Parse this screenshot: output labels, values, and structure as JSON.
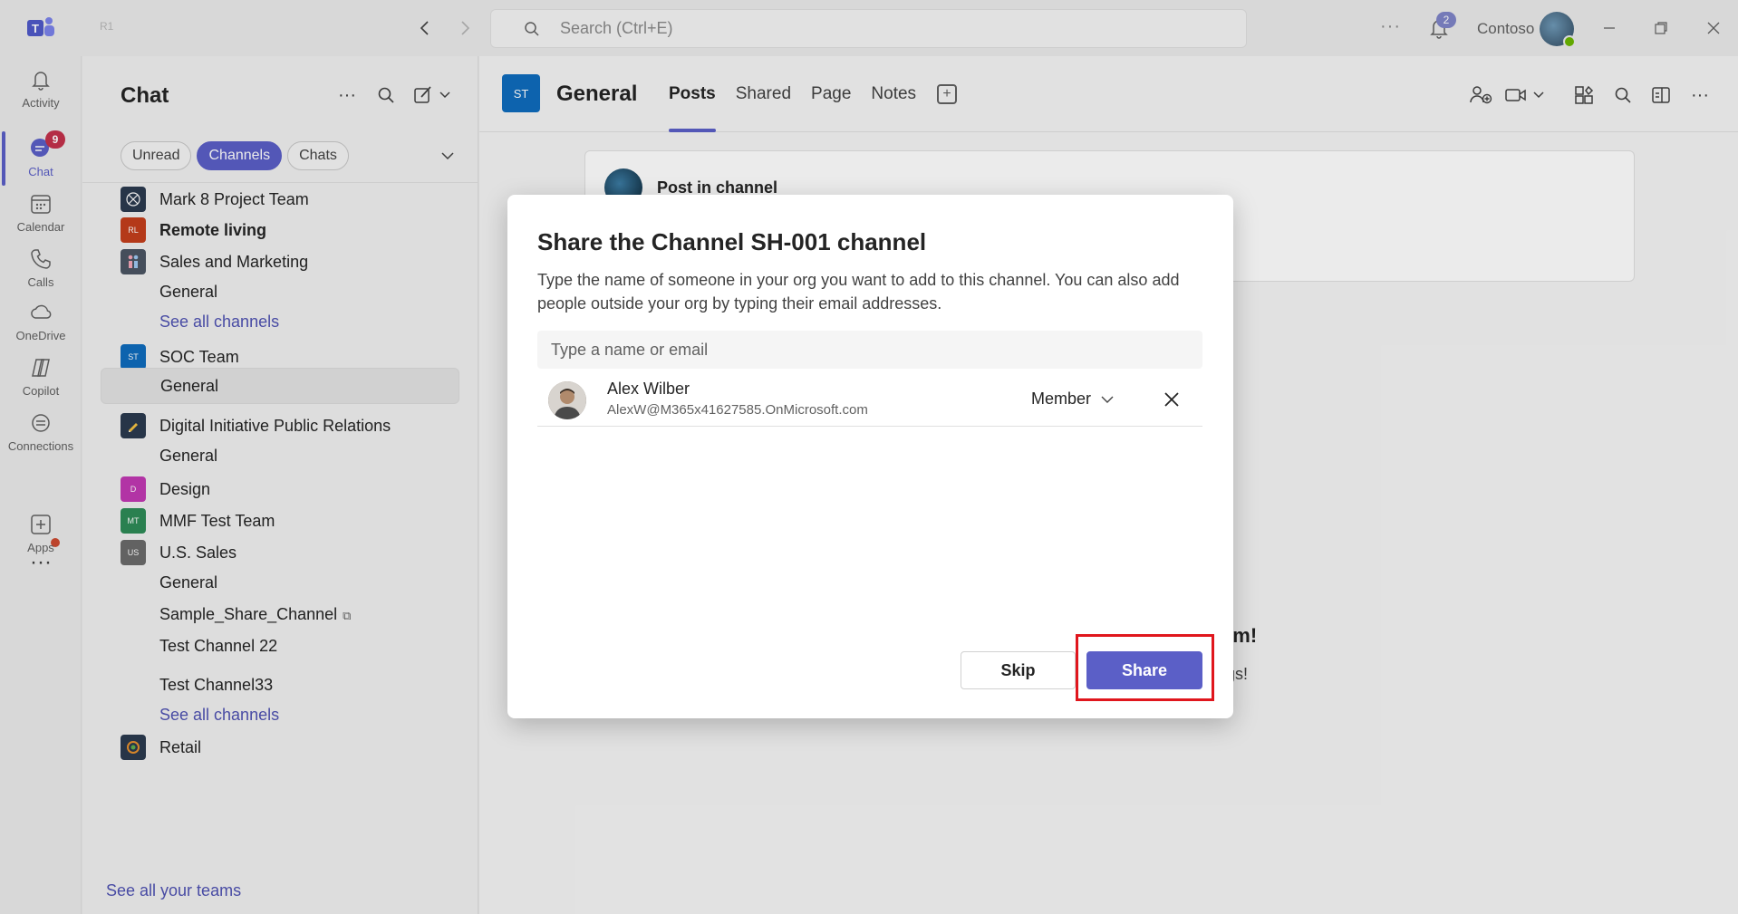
{
  "titlebar": {
    "tenant_tag": "R1",
    "search_placeholder": "Search (Ctrl+E)",
    "notifications_count": "2",
    "org_name": "Contoso"
  },
  "rail": {
    "items": [
      {
        "label": "Activity"
      },
      {
        "label": "Chat",
        "badge": "9"
      },
      {
        "label": "Calendar"
      },
      {
        "label": "Calls"
      },
      {
        "label": "OneDrive"
      },
      {
        "label": "Copilot"
      },
      {
        "label": "Connections"
      },
      {
        "label": "Apps"
      }
    ]
  },
  "chat_panel": {
    "title": "Chat",
    "filters": [
      "Unread",
      "Channels",
      "Chats"
    ],
    "active_filter": "Channels",
    "rows": [
      {
        "label": "Mark 8 Project Team",
        "type": "team",
        "tile": ""
      },
      {
        "label": "Remote living",
        "type": "team",
        "tile": "RL",
        "bold": true
      },
      {
        "label": "Sales and Marketing",
        "type": "team",
        "tile": ""
      },
      {
        "label": "General",
        "type": "channel"
      },
      {
        "label": "See all channels",
        "type": "link"
      },
      {
        "label": "SOC Team",
        "type": "team",
        "tile": "ST"
      },
      {
        "label": "General",
        "type": "channel",
        "selected": true
      },
      {
        "label": "Digital Initiative Public Relations",
        "type": "team",
        "tile": ""
      },
      {
        "label": "General",
        "type": "channel"
      },
      {
        "label": "Design",
        "type": "team",
        "tile": "D"
      },
      {
        "label": "MMF Test Team",
        "type": "team",
        "tile": "MT"
      },
      {
        "label": "U.S. Sales",
        "type": "team",
        "tile": "US"
      },
      {
        "label": "General",
        "type": "channel"
      },
      {
        "label": "Sample_Share_Channel",
        "type": "channel",
        "shared": true
      },
      {
        "label": "Test Channel 22",
        "type": "channel"
      },
      {
        "label": "Test Channel33",
        "type": "channel"
      },
      {
        "label": "See all channels",
        "type": "link"
      },
      {
        "label": "Retail",
        "type": "team",
        "tile": ""
      }
    ],
    "see_all_teams": "See all your teams"
  },
  "main": {
    "channel_tile": "ST",
    "channel_name": "General",
    "tabs": [
      "Posts",
      "Shared",
      "Page",
      "Notes"
    ],
    "active_tab": "Posts",
    "post_in_channel": "Post in channel",
    "bg_heading_fragment": "m!",
    "bg_sub_fragment": "ings!"
  },
  "dialog": {
    "title": "Share the Channel SH-001 channel",
    "description": "Type the name of someone in your org you want to add to this channel. You can also add people outside your org by typing their email addresses.",
    "input_placeholder": "Type a name or email",
    "person": {
      "name": "Alex Wilber",
      "email": "AlexW@M365x41627585.OnMicrosoft.com",
      "role": "Member"
    },
    "skip_label": "Skip",
    "share_label": "Share"
  },
  "colors": {
    "brand": "#5b5fc7",
    "highlight": "#e0161d",
    "badge_red": "#c4314b",
    "presence_green": "#6bb700"
  }
}
